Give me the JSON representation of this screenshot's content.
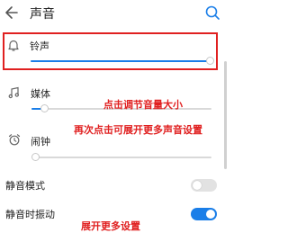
{
  "header": {
    "title": "声音"
  },
  "volume": {
    "ringtone": {
      "label": "铃声",
      "level_percent": 100
    },
    "media": {
      "label": "媒体",
      "level_percent": 6
    },
    "alarm": {
      "label": "闹钟",
      "level_percent": 0
    }
  },
  "toggles": {
    "silent_mode": {
      "label": "静音模式",
      "state": "off"
    },
    "vibrate_silent": {
      "label": "静音时振动",
      "state": "on"
    }
  },
  "annotations": {
    "adjust_volume": "点击调节音量大小",
    "expand_more": "再次点击可展开更多声音设置",
    "expand_settings": "展开更多设置"
  },
  "colors": {
    "accent": "#1a7ee8",
    "annotation": "#e02020",
    "highlight_box": "#e02020"
  }
}
